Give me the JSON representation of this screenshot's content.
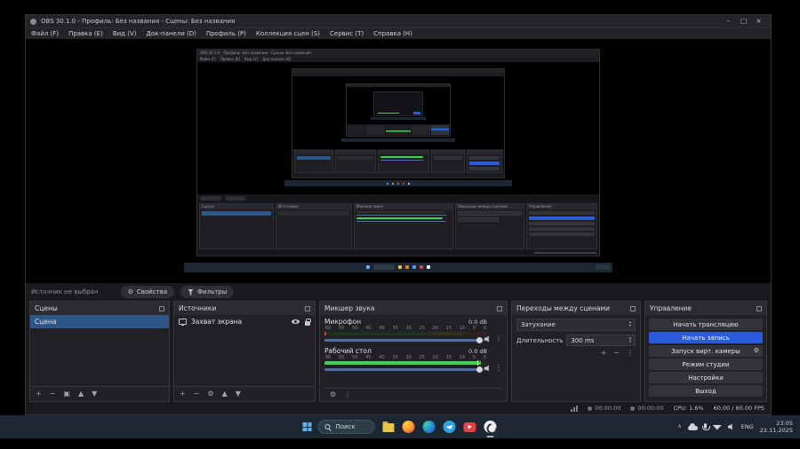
{
  "window": {
    "title": "OBS 30.1.0 - Профиль: Без названия - Сцены: Без названия"
  },
  "icons": {
    "minimize": "–",
    "maximize": "□",
    "close": "×",
    "plus": "+",
    "remove": "−",
    "gear": "⚙",
    "up": "▲",
    "down": "▼",
    "grid": "▣",
    "dots": "⋮",
    "spin_up": "▴",
    "spin_down": "▾",
    "chevron_up": "∧"
  },
  "menubar": {
    "items": [
      {
        "label": "Файл (F)"
      },
      {
        "label": "Правка (E)"
      },
      {
        "label": "Вид (V)"
      },
      {
        "label": "Док-панели (D)"
      },
      {
        "label": "Профиль (P)"
      },
      {
        "label": "Коллекция сцен (S)"
      },
      {
        "label": "Сервис (T)"
      },
      {
        "label": "Справка (H)"
      }
    ]
  },
  "context_bar": {
    "status": "Источник не выбран",
    "properties_label": "Свойства",
    "filters_label": "Фильтры"
  },
  "panels": {
    "scenes": {
      "title": "Сцены",
      "items": [
        {
          "name": "Сцена"
        }
      ]
    },
    "sources": {
      "title": "Источники",
      "items": [
        {
          "name": "Захват экрана"
        }
      ]
    },
    "mixer": {
      "title": "Микшер звука",
      "scale": "60 55 50 45 40 35 30 25 20 15 10 5 0",
      "channels": [
        {
          "name": "Микрофон",
          "level": "0.0 dB"
        },
        {
          "name": "Рабочий стол",
          "level": "0.0 dB"
        }
      ]
    },
    "transitions": {
      "title": "Переходы между сценами",
      "transition_value": "Затухание",
      "duration_label": "Длительность",
      "duration_value": "300 ms"
    },
    "controls": {
      "title": "Управление",
      "buttons": [
        "Начать трансляцию",
        "Начать запись",
        "Запуск вирт. камеры",
        "Режим студии",
        "Настройки",
        "Выход"
      ]
    }
  },
  "statusbar": {
    "stream_timer": "00:00:00",
    "record_timer": "00:00:00",
    "cpu": "CPU: 1.6%",
    "fps": "60.00 / 60.00 FPS"
  },
  "taskbar": {
    "search_placeholder": "Поиск",
    "language": "ENG",
    "clock": {
      "time": "23:05",
      "date": "22.11.2025"
    }
  },
  "colors": {
    "accent_blue": "#2a5ade",
    "selection_blue": "#2e5587",
    "meter_green": "#45cf50",
    "taskbar_bg": "#1d2733"
  }
}
